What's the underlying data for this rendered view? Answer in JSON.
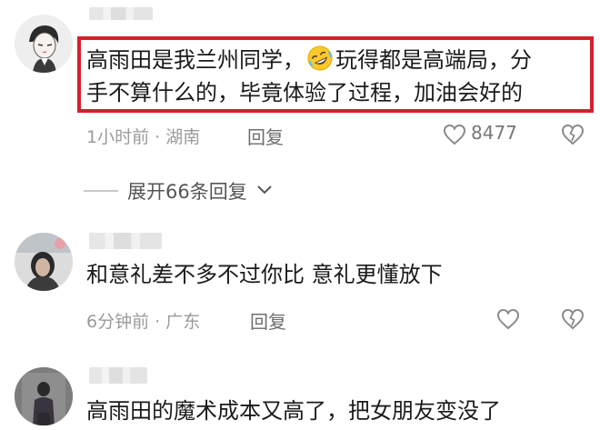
{
  "comments": [
    {
      "text_line1_a": "高雨田是我兰州同学，",
      "emoji_icon": "rofl-emoji",
      "text_line1_b": "玩得都是高端局，分",
      "text_line2": "手不算什么的，毕竟体验了过程，加油会好的",
      "meta": "1小时前 · 湖南",
      "reply_label": "回复",
      "like_count": "8477"
    },
    {
      "text": "和意礼差不多不过你比 意礼更懂放下",
      "meta": "6分钟前 · 广东",
      "reply_label": "回复"
    },
    {
      "text": "高雨田的魔术成本又高了，把女朋友变没了"
    }
  ],
  "expand": {
    "label": "展开66条回复",
    "icon": "chevron-down-icon"
  },
  "colors": {
    "highlight_border": "#d7202a",
    "meta_text": "#9b9b9b",
    "icon_stroke": "#8a8a8a"
  }
}
